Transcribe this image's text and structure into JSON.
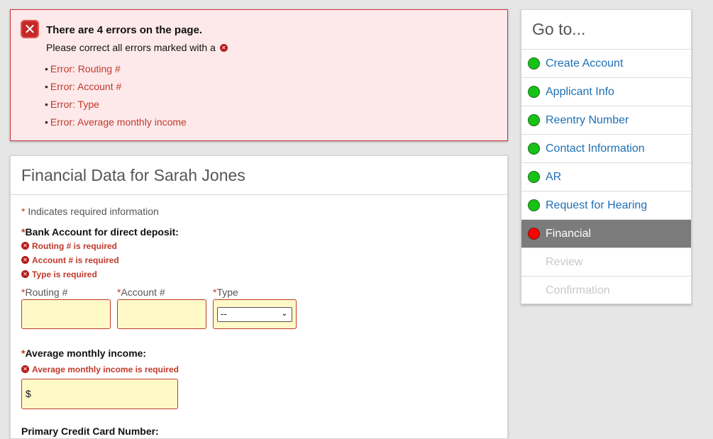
{
  "errors": {
    "title": "There are 4 errors on the page.",
    "subtitle": "Please correct all errors marked with a",
    "items": [
      "Error: Routing #",
      "Error: Account #",
      "Error: Type",
      "Error: Average monthly income"
    ]
  },
  "form": {
    "title": "Financial Data for Sarah Jones",
    "required_note": "Indicates required information",
    "required_mark": "*",
    "bank_label": "Bank Account for direct deposit:",
    "bank_errors": [
      "Routing # is required",
      "Account # is required",
      "Type is required"
    ],
    "routing_label": "Routing #",
    "account_label": "Account #",
    "type_label": "Type",
    "type_selected": "--",
    "income_label": "Average monthly income:",
    "income_error": "Average monthly income is required",
    "income_prefix": "$",
    "credit_label": "Primary Credit Card Number:"
  },
  "nav": {
    "title": "Go to...",
    "items": [
      {
        "label": "Create Account",
        "status": "complete"
      },
      {
        "label": "Applicant Info",
        "status": "complete"
      },
      {
        "label": "Reentry Number",
        "status": "complete"
      },
      {
        "label": "Contact Information",
        "status": "complete"
      },
      {
        "label": "AR",
        "status": "complete"
      },
      {
        "label": "Request for Hearing",
        "status": "complete"
      },
      {
        "label": "Financial",
        "status": "current"
      },
      {
        "label": "Review",
        "status": "disabled"
      },
      {
        "label": "Confirmation",
        "status": "disabled"
      }
    ]
  },
  "colors": {
    "error_red": "#c0392b",
    "field_bg": "#fff9c8",
    "link_blue": "#1f6fb5",
    "status_complete": "#16c216",
    "status_current": "#ff0000",
    "active_bg": "#7b7b7b"
  },
  "icons": {
    "error_badge": "x-icon",
    "error_mark": "error-x-icon",
    "select_caret": "chevron-down-icon"
  }
}
